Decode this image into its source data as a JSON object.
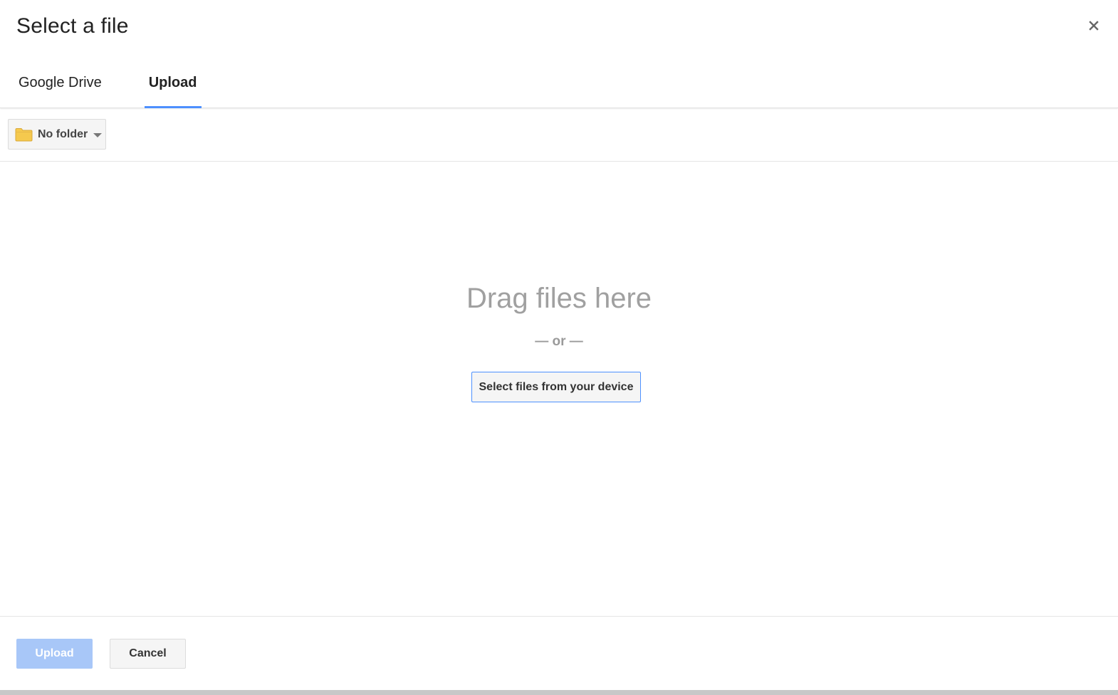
{
  "dialog": {
    "title": "Select a file"
  },
  "tabs": [
    {
      "label": "Google Drive",
      "active": false
    },
    {
      "label": "Upload",
      "active": true
    }
  ],
  "toolbar": {
    "folder_label": "No folder",
    "folder_icon": "folder-icon"
  },
  "dropzone": {
    "drag_text": "Drag files here",
    "or_text": "— or —",
    "select_button": "Select files from your device"
  },
  "footer": {
    "upload_label": "Upload",
    "cancel_label": "Cancel"
  },
  "colors": {
    "accent": "#4d90fe",
    "upload_disabled": "#a8c7f8",
    "folder": "#f5c94e"
  }
}
